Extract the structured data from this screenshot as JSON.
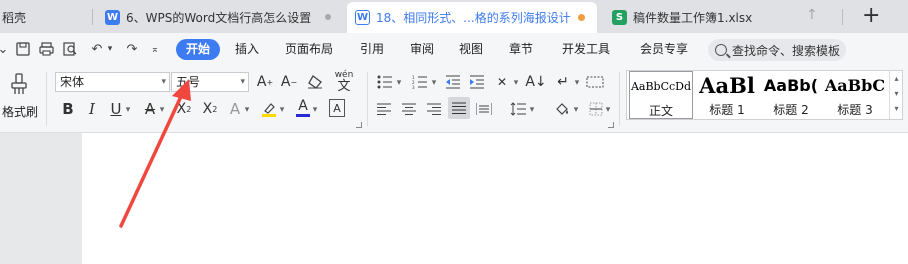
{
  "tabs": [
    {
      "label": "稻壳",
      "active": false
    },
    {
      "label": "6、WPS的Word文档行高怎么设置",
      "active": false,
      "icon": "W",
      "icon_color": "#3d7bf0"
    },
    {
      "label": "18、相同形式、...格的系列海报设计",
      "active": true,
      "icon": "W",
      "icon_color": "#3d7bf0",
      "modified": true
    },
    {
      "label": "稿件数量工作簿1.xlsx",
      "active": false,
      "icon": "S",
      "icon_color": "#23a060"
    }
  ],
  "tabbar_icons": [
    "up-arrow-icon",
    "plus-icon"
  ],
  "ribbon_tabs": [
    "开始",
    "插入",
    "页面布局",
    "引用",
    "审阅",
    "视图",
    "章节",
    "开发工具",
    "会员专享"
  ],
  "search_placeholder": "查找命令、搜索模板",
  "toolbar": {
    "format_painter_label": "格式刷",
    "font_name": "宋体",
    "font_size": "五号",
    "spacing_icon_label": "wén"
  },
  "styles": [
    {
      "sample": "AaBbCcDd",
      "name": "正文"
    },
    {
      "sample": "AaBl",
      "name": "标题 1"
    },
    {
      "sample": "AaBb(",
      "name": "标题 2"
    },
    {
      "sample": "AaBbC",
      "name": "标题 3"
    }
  ],
  "colors": {
    "accent": "#3d7bf0",
    "annotation_arrow": "#f0483e",
    "modified_dot": "#f39c3c"
  }
}
